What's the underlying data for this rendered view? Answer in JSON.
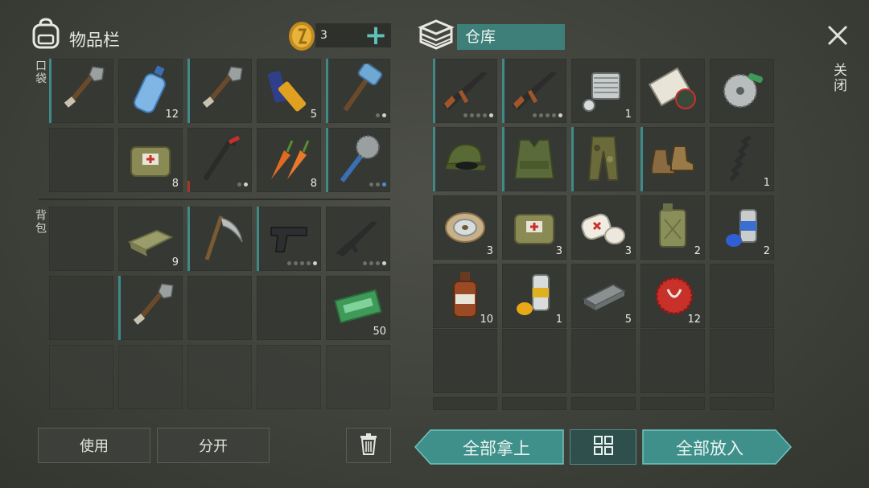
{
  "inventory": {
    "title": "物品栏",
    "coins": "3",
    "add_label": "+",
    "pocket_label": "口袋",
    "backpack_label": "背包",
    "pocket_slots": [
      {
        "icon": "shovel-icon",
        "count": "",
        "dur": true,
        "dots": ""
      },
      {
        "icon": "water-bottle-icon",
        "count": "12",
        "dur": false,
        "dots": ""
      },
      {
        "icon": "shovel-icon",
        "count": "",
        "dur": true,
        "dots": ""
      },
      {
        "icon": "battery-icon",
        "count": "5",
        "dur": false,
        "dots": ""
      },
      {
        "icon": "sledgehammer-icon",
        "count": "",
        "dur": true,
        "dots": "2"
      },
      {
        "icon": "",
        "count": "",
        "dur": false,
        "dots": ""
      },
      {
        "icon": "medkit-bag-icon",
        "count": "8",
        "dur": false,
        "dots": ""
      },
      {
        "icon": "crowbar-icon",
        "count": "",
        "dur": "red",
        "dots": "2"
      },
      {
        "icon": "carrot-icon",
        "count": "8",
        "dur": false,
        "dots": ""
      },
      {
        "icon": "saw-blade-club-icon",
        "count": "",
        "dur": true,
        "dots": "3b"
      }
    ],
    "backpack_slots": [
      {
        "icon": "",
        "count": "",
        "dur": false,
        "dots": ""
      },
      {
        "icon": "cloth-icon",
        "count": "9",
        "dur": false,
        "dots": ""
      },
      {
        "icon": "scythe-icon",
        "count": "",
        "dur": true,
        "dots": ""
      },
      {
        "icon": "pistol-icon",
        "count": "",
        "dur": true,
        "dots": "5"
      },
      {
        "icon": "assault-rifle-icon",
        "count": "",
        "dur": false,
        "dots": "4"
      },
      {
        "icon": "",
        "count": "",
        "dur": false,
        "dots": ""
      },
      {
        "icon": "shovel-icon",
        "count": "",
        "dur": true,
        "dots": ""
      },
      {
        "icon": "",
        "count": "",
        "dur": false,
        "dots": ""
      },
      {
        "icon": "",
        "count": "",
        "dur": false,
        "dots": ""
      },
      {
        "icon": "ration-coupon-icon",
        "count": "50",
        "dur": false,
        "dots": ""
      }
    ],
    "use_label": "使用",
    "split_label": "分开"
  },
  "storage": {
    "title": "仓库",
    "slots": [
      {
        "icon": "ak47-icon",
        "count": "",
        "dur": true,
        "dots": "5"
      },
      {
        "icon": "ak47-icon",
        "count": "",
        "dur": true,
        "dots": "5"
      },
      {
        "icon": "engine-part-icon",
        "count": "1",
        "dur": false,
        "dots": ""
      },
      {
        "icon": "map-scroll-icon",
        "count": "",
        "dur": false,
        "dots": ""
      },
      {
        "icon": "saw-blade-icon",
        "count": "",
        "dur": false,
        "dots": ""
      },
      {
        "icon": "military-cap-icon",
        "count": "",
        "dur": true,
        "dots": ""
      },
      {
        "icon": "tactical-vest-icon",
        "count": "",
        "dur": true,
        "dots": ""
      },
      {
        "icon": "camo-pants-icon",
        "count": "",
        "dur": true,
        "dots": ""
      },
      {
        "icon": "boots-icon",
        "count": "",
        "dur": true,
        "dots": ""
      },
      {
        "icon": "spring-icon",
        "count": "1",
        "dur": false,
        "dots": ""
      },
      {
        "icon": "wire-spool-icon",
        "count": "3",
        "dur": false,
        "dots": ""
      },
      {
        "icon": "medkit-bag-icon",
        "count": "3",
        "dur": false,
        "dots": ""
      },
      {
        "icon": "bandage-icon",
        "count": "3",
        "dur": false,
        "dots": ""
      },
      {
        "icon": "jerrycan-icon",
        "count": "2",
        "dur": false,
        "dots": ""
      },
      {
        "icon": "spray-paint-blue-icon",
        "count": "2",
        "dur": false,
        "dots": ""
      },
      {
        "icon": "bottle-icon",
        "count": "10",
        "dur": false,
        "dots": ""
      },
      {
        "icon": "spray-paint-yellow-icon",
        "count": "1",
        "dur": false,
        "dots": ""
      },
      {
        "icon": "metal-bar-icon",
        "count": "5",
        "dur": false,
        "dots": ""
      },
      {
        "icon": "bottle-cap-icon",
        "count": "12",
        "dur": false,
        "dots": ""
      },
      {
        "icon": "",
        "count": "",
        "dur": false,
        "dots": ""
      }
    ],
    "take_all_label": "全部拿上",
    "put_all_label": "全部放入"
  },
  "close_label": "关闭",
  "colors": {
    "accent": "#3f8f8a",
    "slot": "#363833",
    "bg": "#3f413b"
  }
}
